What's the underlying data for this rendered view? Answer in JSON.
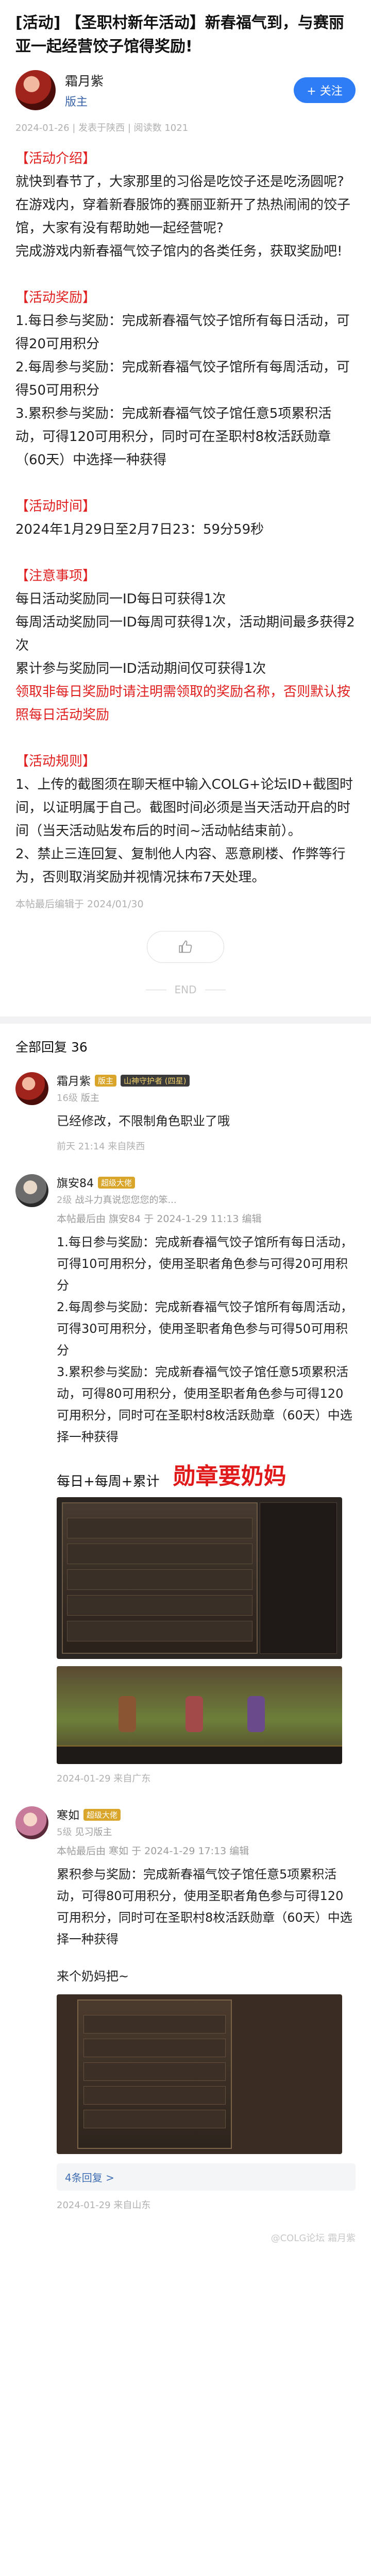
{
  "post": {
    "title": "[活动] 【圣职村新年活动】新春福气到，与赛丽亚一起经营饺子馆得奖励!",
    "author": "霜月紫",
    "author_badge": "版主",
    "follow_label": "+ 关注",
    "meta": "2024-01-26 | 发表于陕西 | 阅读数 1021"
  },
  "content": {
    "intro_title": "【活动介绍】",
    "intro_lines": [
      "就快到春节了，大家那里的习俗是吃饺子还是吃汤圆呢?",
      "在游戏内，穿着新春服饰的赛丽亚新开了热热闹闹的饺子馆，大家有没有帮助她一起经营呢?",
      "完成游戏内新春福气饺子馆内的各类任务，获取奖励吧!"
    ],
    "reward_title": "【活动奖励】",
    "reward_lines": [
      "1.每日参与奖励：完成新春福气饺子馆所有每日活动，可得20可用积分",
      "2.每周参与奖励：完成新春福气饺子馆所有每周活动，可得50可用积分",
      "3.累积参与奖励：完成新春福气饺子馆任意5项累积活动，可得120可用积分，同时可在圣职村8枚活跃勋章（60天）中选择一种获得"
    ],
    "time_title": "【活动时间】",
    "time_text": "2024年1月29日至2月7日23：59分59秒",
    "notice_title": "【注意事项】",
    "notice_lines": [
      "每日活动奖励同一ID每日可获得1次",
      "每周活动奖励同一ID每周可获得1次，活动期间最多获得2次",
      "累计参与奖励同一ID活动期间仅可获得1次"
    ],
    "notice_red": "领取非每日奖励时请注明需领取的奖励名称，否则默认按照每日活动奖励",
    "rules_title": "【活动规则】",
    "rules_lines": [
      "1、上传的截图须在聊天框中输入COLG+论坛ID+截图时间，以证明属于自己。截图时间必须是当天活动开启的时间（当天活动贴发布后的时间~活动帖结束前）。",
      "2、禁止三连回复、复制他人内容、恶意刷楼、作弊等行为，否则取消奖励并视情况抹布7天处理。"
    ],
    "edited": "本帖最后编辑于 2024/01/30",
    "end_label": "END"
  },
  "comments_header": {
    "label": "全部回复",
    "count": "36"
  },
  "comments": [
    {
      "name": "霜月紫",
      "tag1": "版主",
      "tag2": "山神守护者 (四星)",
      "level": "16级",
      "badge": "版主",
      "text": "已经修改，不限制角色职业了哦",
      "time": "前天 21:14 来自陕西"
    },
    {
      "name": "旗安84",
      "tag1": "超级大佬",
      "level": "2级",
      "sub": "战斗力真说您您您的笨...",
      "edit": "本帖最后由 旗安84 于 2024-1-29 11:13 编辑",
      "lines": [
        "1.每日参与奖励：完成新春福气饺子馆所有每日活动，可得10可用积分，使用圣职者角色参与可得20可用积分",
        "2.每周参与奖励：完成新春福气饺子馆所有每周活动，可得30可用积分，使用圣职者角色参与可得50可用积分",
        "3.累积参与奖励：完成新春福气饺子馆任意5项累积活动，可得80可用积分，使用圣职者角色参与可得120可用积分，同时可在圣职村8枚活跃勋章（60天）中选择一种获得"
      ],
      "promo_left": "每日+每周+累计",
      "promo_right": "勋章要奶妈",
      "time": "2024-01-29 来自广东"
    },
    {
      "name": "寒如",
      "tag1": "超级大佬",
      "level": "5级",
      "sub": "见习版主",
      "edit": "本帖最后由 寒如 于 2024-1-29 17:13 编辑",
      "text": "累积参与奖励：完成新春福气饺子馆任意5项累积活动，可得80可用积分，使用圣职者角色参与可得120可用积分，同时可在圣职村8枚活跃勋章（60天）中选择一种获得",
      "text2": "来个奶妈把~",
      "replies": "4条回复 >",
      "time": "2024-01-29 来自山东"
    }
  ],
  "watermark": "@COLG论坛 霜月紫"
}
